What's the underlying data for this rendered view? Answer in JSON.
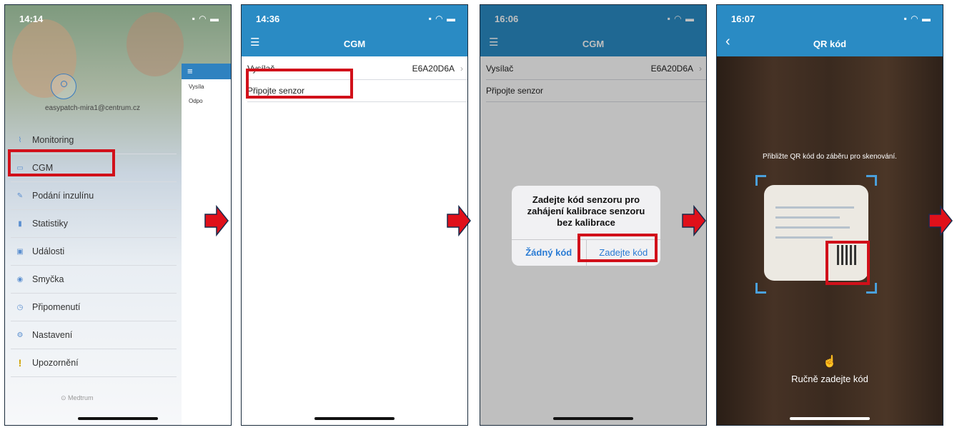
{
  "phone1": {
    "time": "14:14",
    "email": "easypatch-mira1@centrum.cz",
    "panel_items": [
      "Vysíla",
      "Odpo"
    ],
    "menu": [
      {
        "label": "Monitoring",
        "icon": "chart-icon"
      },
      {
        "label": "CGM",
        "icon": "sensor-icon"
      },
      {
        "label": "Podání inzulínu",
        "icon": "pen-icon"
      },
      {
        "label": "Statistiky",
        "icon": "bars-icon"
      },
      {
        "label": "Události",
        "icon": "clipboard-icon"
      },
      {
        "label": "Smyčka",
        "icon": "loop-icon"
      },
      {
        "label": "Připomenutí",
        "icon": "clock-icon"
      },
      {
        "label": "Nastavení",
        "icon": "gear-icon"
      },
      {
        "label": "Upozornění",
        "icon": "exclamation-icon"
      }
    ],
    "logo": "Medtrum"
  },
  "phone2": {
    "time": "14:36",
    "title": "CGM",
    "rows": [
      {
        "label": "Vysílač",
        "value": "E6A20D6A"
      },
      {
        "label": "Připojte senzor",
        "value": ""
      }
    ]
  },
  "phone3": {
    "time": "16:06",
    "title": "CGM",
    "rows": [
      {
        "label": "Vysílač",
        "value": "E6A20D6A"
      },
      {
        "label": "Připojte senzor",
        "value": ""
      }
    ],
    "dialog": {
      "message": "Zadejte kód senzoru pro zahájení kalibrace senzoru bez kalibrace",
      "btn_no_code": "Žádný kód",
      "btn_enter_code": "Zadejte kód"
    }
  },
  "phone4": {
    "time": "16:07",
    "title": "QR kód",
    "prompt": "Přibližte QR kód do záběru pro skenování.",
    "manual": "Ručně zadejte kód"
  },
  "colors": {
    "accent": "#2a8bc4",
    "highlight": "#d1101a",
    "link": "#2a7bd4"
  }
}
